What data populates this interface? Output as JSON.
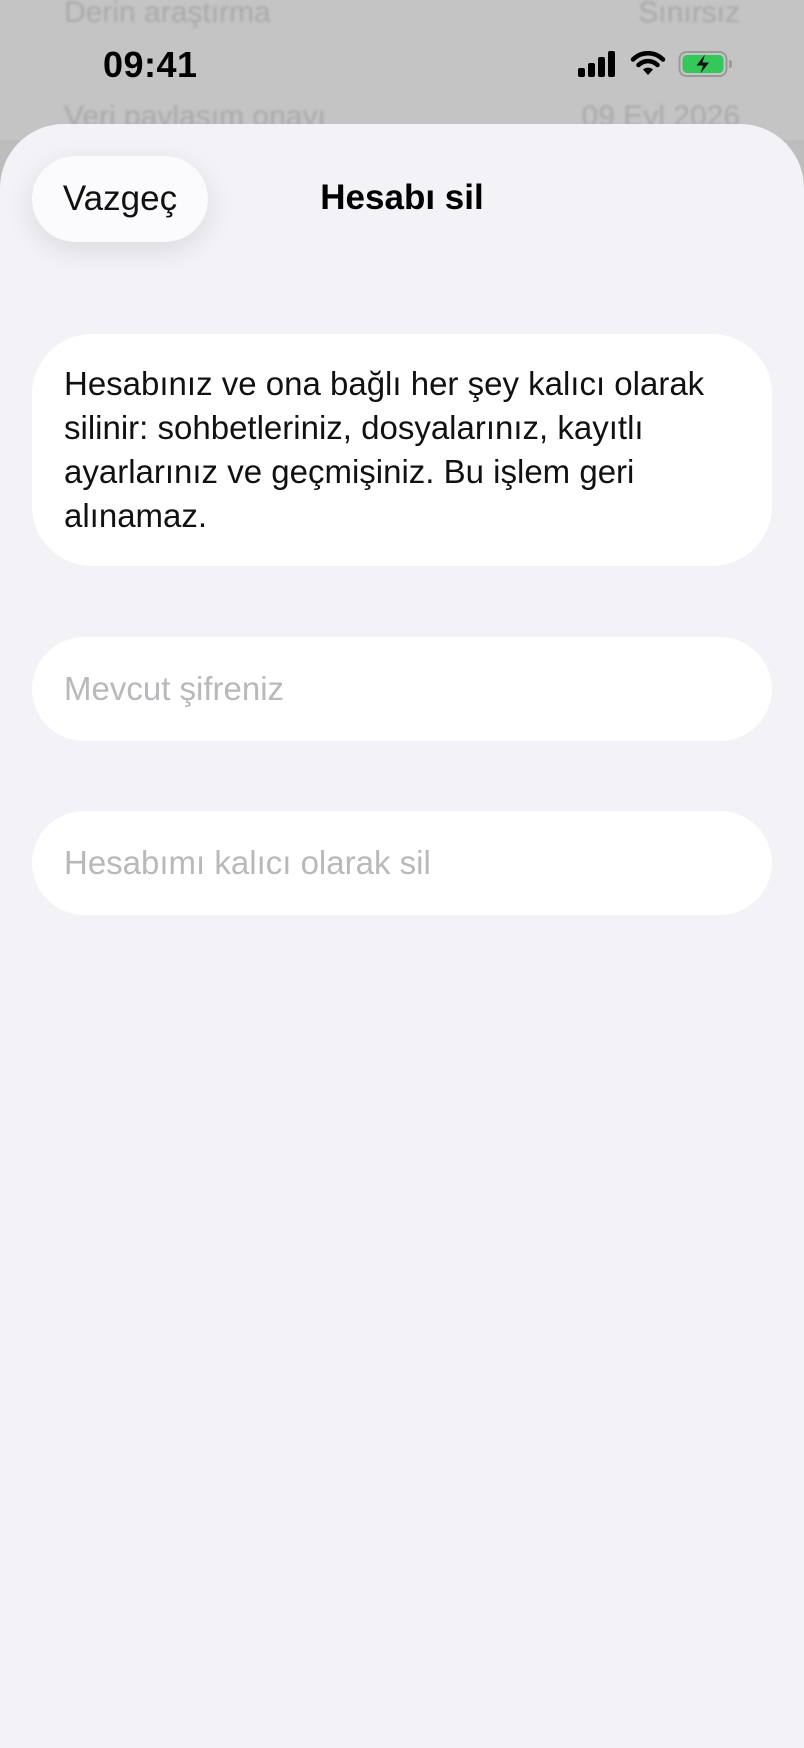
{
  "background": {
    "row1_label": "Derin araştırma",
    "row1_value": "Sınırsız",
    "row2_label": "Veri paylaşım onayı",
    "row2_value": "09 Eyl 2026"
  },
  "status_bar": {
    "time": "09:41",
    "icons": [
      "cellular-signal-icon",
      "wifi-icon",
      "battery-charging-icon"
    ],
    "battery_color": "#34c759"
  },
  "sheet": {
    "cancel_label": "Vazgeç",
    "title": "Hesabı sil",
    "info_text": "Hesabınız ve ona bağlı her şey kalıcı olarak silinir: sohbetleriniz, dosyalarınız, kayıtlı ayarlarınız ve geçmişiniz. Bu işlem geri alınamaz.",
    "password_field": {
      "value": "",
      "placeholder": "Mevcut şifreniz"
    },
    "confirm_field": {
      "value": "",
      "placeholder": "Hesabımı kalıcı olarak sil"
    }
  },
  "colors": {
    "sheet_background": "#f2f2f7",
    "card_background": "#ffffff",
    "placeholder": "#b8b8bd"
  }
}
